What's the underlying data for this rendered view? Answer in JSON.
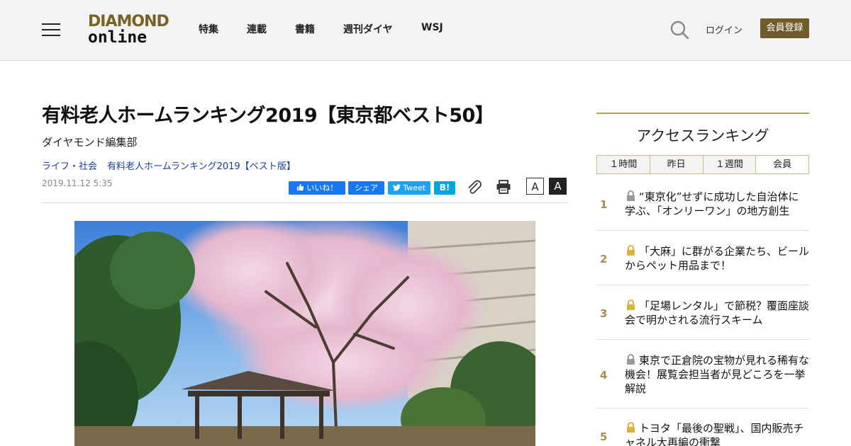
{
  "header": {
    "logo_top": "DIAMOND",
    "logo_bottom": "online",
    "nav": [
      "特集",
      "連載",
      "書籍",
      "週刊ダイヤ",
      "WSJ"
    ],
    "login": "ログイン",
    "register": "会員登録"
  },
  "article": {
    "title": "有料老人ホームランキング2019【東京都ベスト50】",
    "author": "ダイヤモンド編集部",
    "breadcrumbs": [
      "ライフ・社会",
      "有料老人ホームランキング2019【ベスト版】"
    ],
    "date": "2019.11.12 5:35",
    "share": {
      "facebook": "いいね！",
      "share": "シェア",
      "tweet": "Tweet",
      "hatena": "B!"
    },
    "font_small": "A",
    "font_large": "A"
  },
  "sidebar": {
    "title": "アクセスランキング",
    "tabs": [
      "１時間",
      "昨日",
      "１週間",
      "会員"
    ],
    "active_tab": "会員",
    "items": [
      {
        "rank": "1",
        "text": "“東京化”せずに成功した自治体に学ぶ、「オンリーワン」の地方創生",
        "lock": "gray"
      },
      {
        "rank": "2",
        "text": "「大麻」に群がる企業たち、ビールからペット用品まで！",
        "lock": "gold"
      },
      {
        "rank": "3",
        "text": "「足場レンタル」で節税？覆面座談会で明かされる流行スキーム",
        "lock": "gold"
      },
      {
        "rank": "4",
        "text": "東京で正倉院の宝物が見れる稀有な機会！展覧会担当者が見どころを一挙解説",
        "lock": "gray"
      },
      {
        "rank": "5",
        "text": "トヨタ「最後の聖戦」、国内販売チャネル大再編の衝撃",
        "lock": "gold"
      }
    ]
  },
  "colors": {
    "brand_gold": "#6f5b2c",
    "rank_gold": "#a98f4f",
    "link_blue": "#1a3e93",
    "facebook": "#1877f2",
    "twitter": "#1da1f2",
    "hatena": "#00a4de"
  }
}
